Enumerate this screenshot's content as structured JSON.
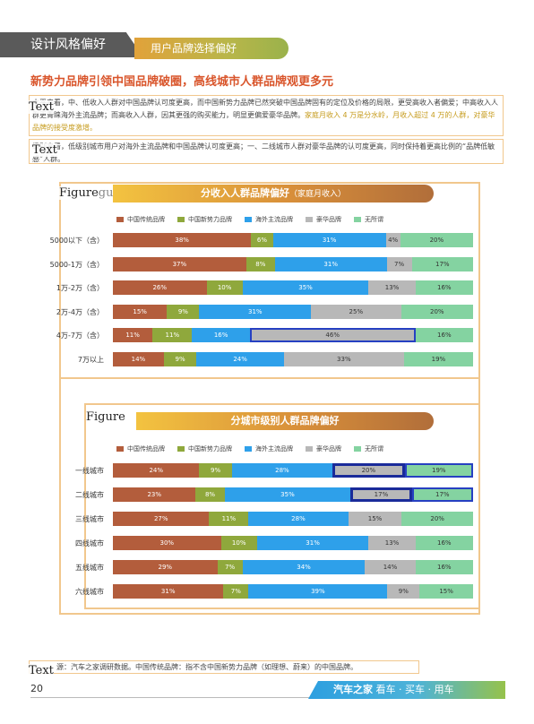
{
  "header": {
    "section": "设计风格偏好",
    "subsection": "用户品牌选择偏好"
  },
  "main_title": "新势力品牌引领中国品牌破圈，高线城市人群品牌观更多元",
  "paragraph1": {
    "tag": "Text",
    "text": "水平来看，中、低收入人群对中国品牌认可度更高，而中国新势力品牌已然突破中国品牌固有的定位及价格的局限，更受高收入者偏爱；中高收入人群更青睐海外主流品牌；而高收入人群，因其更强的购买能力，明显更偏爱豪华品牌。",
    "highlight": "家庭月收入 4 万是分水岭，月收入超过 4 万的人群，对豪华品牌的接受度激增。"
  },
  "paragraph2": {
    "tag": "Text",
    "text": "级别来看，低级别城市用户对海外主流品牌和中国品牌认可度更高；一、二线城市人群对豪华品牌的认可度更高，同时保持着更高比例的“品牌低敏感”人群。"
  },
  "colors": {
    "中国传统品牌": "#b35d3c",
    "中国新势力品牌": "#8fa83c",
    "海外主流品牌": "#2ea0ea",
    "豪华品牌": "#b8b8b8",
    "无所谓": "#84d3a1"
  },
  "chart_data": [
    {
      "type": "bar",
      "orientation": "horizontal-stacked-100",
      "tag": "Figure",
      "tag_suffix": "gure",
      "title": "分收入人群品牌偏好",
      "subtitle": "（家庭月收入）",
      "legend": [
        "中国传统品牌",
        "中国新势力品牌",
        "海外主流品牌",
        "豪华品牌",
        "无所谓"
      ],
      "categories": [
        "5000以下（含）",
        "5000-1万（含）",
        "1万-2万（含）",
        "2万-4万（含）",
        "4万-7万（含）",
        "7万以上"
      ],
      "series": [
        {
          "name": "中国传统品牌",
          "values": [
            38,
            37,
            26,
            15,
            11,
            14
          ]
        },
        {
          "name": "中国新势力品牌",
          "values": [
            6,
            8,
            10,
            9,
            11,
            9
          ]
        },
        {
          "name": "海外主流品牌",
          "values": [
            31,
            31,
            35,
            31,
            16,
            24
          ]
        },
        {
          "name": "豪华品牌",
          "values": [
            4,
            7,
            13,
            25,
            46,
            33
          ]
        },
        {
          "name": "无所谓",
          "values": [
            20,
            17,
            16,
            20,
            16,
            19
          ]
        }
      ]
    },
    {
      "type": "bar",
      "orientation": "horizontal-stacked-100",
      "tag": "Figure",
      "title": "分城市级别人群品牌偏好",
      "legend": [
        "中国传统品牌",
        "中国新势力品牌",
        "海外主流品牌",
        "豪华品牌",
        "无所谓"
      ],
      "categories": [
        "一线城市",
        "二线城市",
        "三线城市",
        "四线城市",
        "五线城市",
        "六线城市"
      ],
      "series": [
        {
          "name": "中国传统品牌",
          "values": [
            24,
            23,
            27,
            30,
            29,
            31
          ]
        },
        {
          "name": "中国新势力品牌",
          "values": [
            9,
            8,
            11,
            10,
            7,
            7
          ]
        },
        {
          "name": "海外主流品牌",
          "values": [
            28,
            35,
            28,
            31,
            34,
            39
          ]
        },
        {
          "name": "豪华品牌",
          "values": [
            20,
            17,
            15,
            13,
            14,
            9
          ]
        },
        {
          "name": "无所谓",
          "values": [
            19,
            17,
            20,
            16,
            16,
            15
          ]
        }
      ]
    }
  ],
  "footnote": {
    "tag": "Text",
    "text": "源：汽车之家调研数据。中国传统品牌：指不含中国新势力品牌（如理想、蔚来）的中国品牌。"
  },
  "page_number": "20",
  "footer": {
    "brand": "汽车之家",
    "slogan": " 看车 · 买车 · 用车"
  }
}
